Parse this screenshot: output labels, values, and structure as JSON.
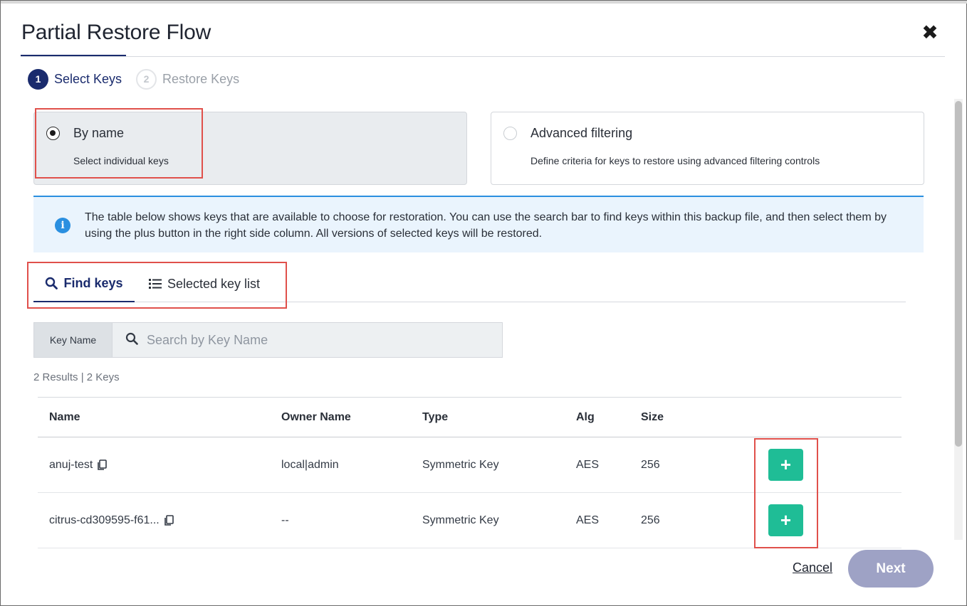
{
  "dialog": {
    "title": "Partial Restore Flow",
    "close_label": "✖"
  },
  "steps": [
    {
      "number": "1",
      "label": "Select Keys",
      "state": "active"
    },
    {
      "number": "2",
      "label": "Restore Keys",
      "state": "inactive"
    }
  ],
  "options": {
    "by_name": {
      "title": "By name",
      "description": "Select individual keys",
      "selected": true
    },
    "advanced": {
      "title": "Advanced filtering",
      "description": "Define criteria for keys to restore using advanced filtering controls",
      "selected": false
    }
  },
  "info": {
    "icon": "info-icon",
    "text": "The table below shows keys that are available to choose for restoration. You can use the search bar to find keys within this backup file, and then select them by using the plus button in the right side column. All versions of selected keys will be restored."
  },
  "tabs": [
    {
      "label": "Find keys",
      "icon": "search-icon",
      "active": true
    },
    {
      "label": "Selected key list",
      "icon": "list-icon",
      "active": false
    }
  ],
  "search": {
    "label": "Key Name",
    "placeholder": "Search by Key Name",
    "value": ""
  },
  "results_summary": "2 Results | 2 Keys",
  "table": {
    "columns": [
      "Name",
      "Owner Name",
      "Type",
      "Alg",
      "Size"
    ],
    "rows": [
      {
        "name": "anuj-test",
        "owner": "local|admin",
        "type": "Symmetric Key",
        "alg": "AES",
        "size": "256",
        "action": "+"
      },
      {
        "name": "citrus-cd309595-f61...",
        "owner": "--",
        "type": "Symmetric Key",
        "alg": "AES",
        "size": "256",
        "action": "+"
      }
    ]
  },
  "footer": {
    "cancel_label": "Cancel",
    "next_label": "Next"
  },
  "colors": {
    "primary": "#1a2b6d",
    "accent_green": "#1fbd96",
    "info_blue": "#2a8fe0",
    "highlight_red": "#e0504b",
    "next_disabled": "#9ea2c5"
  }
}
